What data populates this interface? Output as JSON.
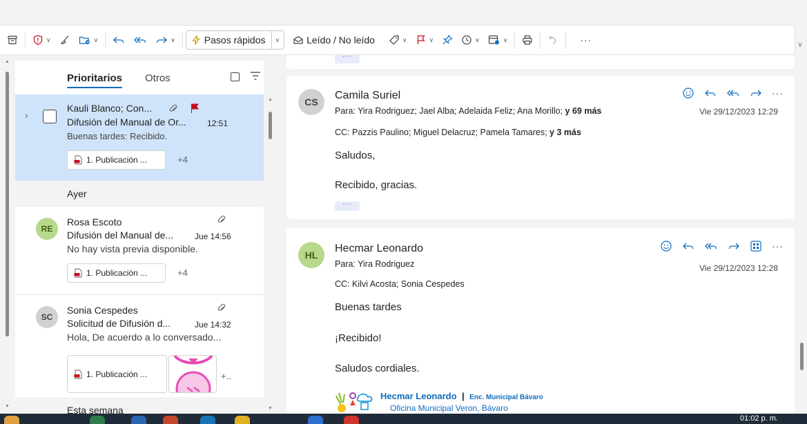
{
  "toolbar": {
    "quick_steps_label": "Pasos rápidos",
    "read_unread_label": "Leído / No leído",
    "more_label": "···"
  },
  "list": {
    "tab_focused": "Prioritarios",
    "tab_other": "Otros",
    "sections": {
      "yesterday": "Ayer",
      "this_week": "Esta semana"
    },
    "items": [
      {
        "from": "Kauli Blanco; Con...",
        "subject": "Difusión del Manual de Or...",
        "time": "12:51",
        "preview": "Buenas tardes: Recibido.",
        "attachment": "1. Publicación ...",
        "more": "+4"
      },
      {
        "initials": "RE",
        "from": "Rosa Escoto",
        "subject": "Difusión del Manual de...",
        "time": "Jue 14:56",
        "preview": "No hay vista previa disponible.",
        "attachment": "1. Publicación ...",
        "more": "+4"
      },
      {
        "initials": "SC",
        "from": "Sonia Cespedes",
        "subject": "Solicitud de Difusión d...",
        "time": "Jue 14:32",
        "preview": "Hola, De acuerdo a lo conversado...",
        "attachment": "1. Publicación ...",
        "more": "+.."
      }
    ]
  },
  "messages": [
    {
      "initials": "CS",
      "sender": "Camila Suriel",
      "to_prefix": "Para:",
      "to": "Yira Rodriguez;  Jael Alba;  Adelaida Feliz;  Ana Morillo;",
      "to_more": "y 69 más",
      "date": "Vie 29/12/2023 12:29",
      "cc_prefix": "CC:",
      "cc": "Pazzis Paulino;  Miguel Delacruz;  Pamela Tamares;",
      "cc_more": "y 3 más",
      "body": [
        "Saludos,",
        "Recibido, gracias."
      ],
      "expand": "···"
    },
    {
      "initials": "HL",
      "sender": "Hecmar Leonardo",
      "to_prefix": "Para:",
      "to": "Yira Rodriguez",
      "date": "Vie 29/12/2023 12:28",
      "cc_prefix": "CC:",
      "cc": "Kilvi Acosta;  Sonia Cespedes",
      "body": [
        "Buenas tardes",
        "¡Recibido!",
        "Saludos cordiales."
      ],
      "signature": {
        "name": "Hecmar Leonardo",
        "separator": "|",
        "role": "Enc. Municipal Bávaro",
        "office": "Oficina Municipal Veron, Bávaro"
      }
    }
  ],
  "prev_expand": "···",
  "taskbar": {
    "clock": "01:02 p. m."
  },
  "colors": {
    "accent": "#0f6cbd",
    "selected": "#cfe4fa",
    "flag": "#c50f1f"
  }
}
